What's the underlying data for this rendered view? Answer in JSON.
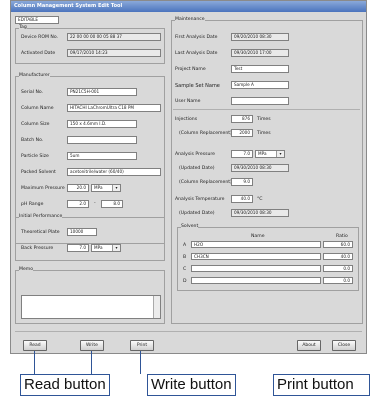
{
  "window": {
    "title": "Column Management System Edit Tool"
  },
  "top_field": "EDITABLE",
  "tag": {
    "title": "Tag",
    "device_rom_label": "Device ROM No.",
    "device_rom_value": "22 00 00 00 00 05 88 37",
    "activated_label": "Activated Date",
    "activated_value": "09/17/2010 14:23"
  },
  "manufacturer": {
    "title": "Manufacturer",
    "serial_label": "Serial No.",
    "serial_value": "PN21C5H-001",
    "column_name_label": "Column Name",
    "column_name_value": "HITACHI LaChromUltra C18 PM",
    "column_size_label": "Column Size",
    "column_size_value": "150 x 4.6mm I.D.",
    "batch_label": "Batch No.",
    "batch_value": "",
    "particle_label": "Particle Size",
    "particle_value": "5um",
    "packed_label": "Packed Solvent",
    "packed_value": "acetonitrile/water (60/40)",
    "maxp_label": "Maximum Pressure",
    "maxp_value": "20.0",
    "maxp_unit": "MPa",
    "ph_label": "pH Range",
    "ph_from": "2.0",
    "ph_sep": "-",
    "ph_to": "8.0"
  },
  "initial": {
    "title": "Initial Performance",
    "plate_label": "Theoretical Plate",
    "plate_value": "10000",
    "backp_label": "Back Pressure",
    "backp_value": "7.0",
    "backp_unit": "MPa"
  },
  "memo": {
    "title": "Memo"
  },
  "maintenance": {
    "title": "Maintenance",
    "first_label": "First Analysis Date",
    "first_value": "09/20/2010 08:30",
    "last_label": "Last Analysis Date",
    "last_value": "09/30/2010 17:00",
    "project_label": "Project Name",
    "project_value": "Test",
    "sampleset_label": "Sample Set Name",
    "sampleset_value": "Sample A",
    "user_label": "User Name",
    "user_value": "",
    "inj_label": "Injections",
    "inj_value": "876",
    "inj_unit": "Times",
    "colrep_label": "(Column Replacement)",
    "colrep_value": "2000",
    "colrep_unit": "Times",
    "ap_label": "Analysis Pressure",
    "ap_value": "7.0",
    "ap_unit": "MPa",
    "ap_updated_label": "(Updated Date)",
    "ap_updated_value": "09/30/2010 08:30",
    "ap_colrep_label": "(Column Replacement)",
    "ap_colrep_value": "9.0",
    "at_label": "Analysis Temperature",
    "at_value": "40.0",
    "at_unit": "°C",
    "at_updated_label": "(Updated Date)",
    "at_updated_value": "09/30/2010 08:30"
  },
  "solvent": {
    "title": "Solvent",
    "col_name": "Name",
    "col_ratio": "Ratio",
    "rows": [
      {
        "letter": "A",
        "name": "H2O",
        "ratio": "60.0"
      },
      {
        "letter": "B",
        "name": "CH3CN",
        "ratio": "40.0"
      },
      {
        "letter": "C",
        "name": "",
        "ratio": "0.0"
      },
      {
        "letter": "D",
        "name": "",
        "ratio": "0.0"
      }
    ]
  },
  "buttons": {
    "read": "Read",
    "write": "Write",
    "print": "Print",
    "about": "About",
    "close": "Close"
  },
  "callouts": {
    "read": "Read button",
    "write": "Write button",
    "print": "Print button"
  },
  "icons": {
    "dropdown": "chevron-down-icon"
  }
}
